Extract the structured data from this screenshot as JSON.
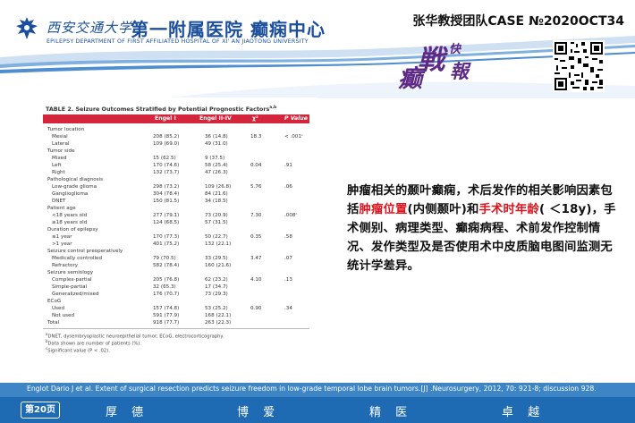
{
  "header": {
    "university_cn": "西安交通大学",
    "dept_cn": "第一附属医院 癫痫中心",
    "dept_en": "EPILEPSY DEPARTMENT OF FIRST AFFILIATED HOSPITAL OF XI' AN JIAOTONG UNIVERSITY",
    "case_id": "张华教授团队CASE №2020OCT34",
    "calligraphy": [
      "癫",
      "戦",
      "快",
      "報"
    ]
  },
  "colors": {
    "brand_blue": "#1b4f9c",
    "table_header_red": "#d3263d",
    "section_red": "#c22b3c",
    "highlight_red": "#e0141e",
    "footer_blue": "#1e6bb3",
    "ref_bar_blue": "#3e85c6",
    "calligraphy_purple": "#5d2a86"
  },
  "table": {
    "title": "TABLE 2. Seizure Outcomes Stratified by Potential Prognostic Factors",
    "title_sup": "a,b",
    "columns": [
      "Engel I",
      "Engel II-IV",
      "χ²",
      "P Value"
    ],
    "rows": [
      {
        "type": "section",
        "label": "Tumor location"
      },
      {
        "type": "sub",
        "label": "Mesial",
        "e1": "208 (85.2)",
        "e2": "36 (14.8)",
        "chi": "18.3",
        "p": "< .001ᶜ"
      },
      {
        "type": "sub",
        "label": "Lateral",
        "e1": "109 (69.0)",
        "e2": "49 (31.0)",
        "chi": "",
        "p": ""
      },
      {
        "type": "section",
        "label": "Tumor side"
      },
      {
        "type": "sub",
        "label": "Mixed",
        "e1": "15 (62.5)",
        "e2": "9 (37.5)",
        "chi": "",
        "p": ""
      },
      {
        "type": "sub",
        "label": "Left",
        "e1": "170 (74.6)",
        "e2": "58 (25.4)",
        "chi": "0.04",
        "p": ".91"
      },
      {
        "type": "sub",
        "label": "Right",
        "e1": "132 (73.7)",
        "e2": "47 (26.3)",
        "chi": "",
        "p": ""
      },
      {
        "type": "section",
        "label": "Pathological diagnosis"
      },
      {
        "type": "sub",
        "label": "Low-grade glioma",
        "e1": "298 (73.2)",
        "e2": "109 (26.8)",
        "chi": "5.76",
        "p": ".06"
      },
      {
        "type": "sub",
        "label": "Ganglioglioma",
        "e1": "304 (78.4)",
        "e2": "84 (21.6)",
        "chi": "",
        "p": ""
      },
      {
        "type": "sub",
        "label": "DNET",
        "e1": "150 (81.5)",
        "e2": "34 (18.5)",
        "chi": "",
        "p": ""
      },
      {
        "type": "section",
        "label": "Patient age"
      },
      {
        "type": "sub",
        "label": "<18 years old",
        "e1": "277 (79.1)",
        "e2": "73 (20.9)",
        "chi": "7.30",
        "p": ".008ᶜ"
      },
      {
        "type": "sub",
        "label": "≥18 years old",
        "e1": "124 (68.5)",
        "e2": "57 (31.5)",
        "chi": "",
        "p": ""
      },
      {
        "type": "section",
        "label": "Duration of epilepsy"
      },
      {
        "type": "sub",
        "label": "≤1 year",
        "e1": "170 (77.3)",
        "e2": "50 (22.7)",
        "chi": "0.35",
        "p": ".58"
      },
      {
        "type": "sub",
        "label": ">1 year",
        "e1": "401 (75.2)",
        "e2": "132 (22.1)",
        "chi": "",
        "p": ""
      },
      {
        "type": "section",
        "label": "Seizure control preoperatively"
      },
      {
        "type": "sub",
        "label": "Medically controlled",
        "e1": "79 (70.5)",
        "e2": "33 (29.5)",
        "chi": "3.47",
        "p": ".07"
      },
      {
        "type": "sub",
        "label": "Refractory",
        "e1": "582 (78.4)",
        "e2": "160 (21.6)",
        "chi": "",
        "p": ""
      },
      {
        "type": "section",
        "label": "Seizure semiology"
      },
      {
        "type": "sub",
        "label": "Complex-partial",
        "e1": "205 (76.8)",
        "e2": "62 (23.2)",
        "chi": "4.10",
        "p": ".13"
      },
      {
        "type": "sub",
        "label": "Simple-partial",
        "e1": "32 (65.3)",
        "e2": "17 (34.7)",
        "chi": "",
        "p": ""
      },
      {
        "type": "sub",
        "label": "Generalized/mixed",
        "e1": "176 (70.7)",
        "e2": "73 (29.3)",
        "chi": "",
        "p": ""
      },
      {
        "type": "section",
        "label": "ECoG"
      },
      {
        "type": "sub",
        "label": "Used",
        "e1": "157 (74.8)",
        "e2": "53 (25.2)",
        "chi": "0.90",
        "p": ".34"
      },
      {
        "type": "sub",
        "label": "Not used",
        "e1": "591 (77.9)",
        "e2": "168 (22.1)",
        "chi": "",
        "p": ""
      },
      {
        "type": "section",
        "label": "Total",
        "e1": "918 (77.7)",
        "e2": "263 (22.3)",
        "chi": "",
        "p": ""
      }
    ],
    "footnotes": [
      {
        "sup": "a",
        "text": "DNET, dysembryoplastic neuroepithelial tumor; ECoG, electrocorticography."
      },
      {
        "sup": "b",
        "text": "Data shown are number of patients (%)."
      },
      {
        "sup": "c",
        "text": "Significant value (P < .02)."
      }
    ]
  },
  "summary": {
    "p1": "肿瘤相关的颞叶癫痫，术后发作的相关影响因素包括",
    "h1": "肿瘤位置",
    "p2": "(内侧颞叶)和",
    "h2": "手术时年龄",
    "p3": "( ＜18y)，手术侧别、病理类型、癫痫病程、术前发作控制情况、发作类型及是否使用术中皮质脑电图间监测无统计学差异。"
  },
  "reference": "Englot Dario J et al. Extent of surgical resection predicts seizure freedom in low-grade temporal lobe brain tumors.[J] .Neurosurgery, 2012, 70: 921-8; discussion 928.",
  "footer": {
    "page": "第20页",
    "motto": [
      "厚 德",
      "博 爱",
      "精 医",
      "卓 越"
    ]
  }
}
